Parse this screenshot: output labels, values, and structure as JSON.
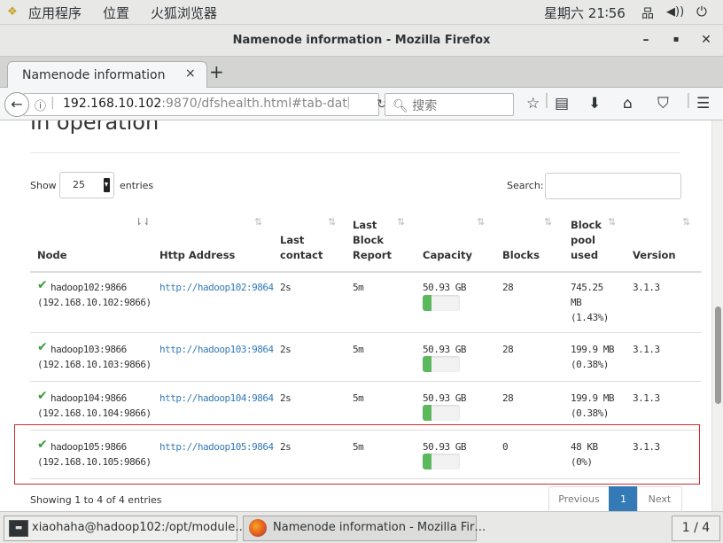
{
  "topbar": {
    "apps": "应用程序",
    "places": "位置",
    "browser": "火狐浏览器",
    "clock": "星期六 21∶56"
  },
  "window": {
    "title": "Namenode information - Mozilla Firefox",
    "minimize": "–",
    "maximize": "▪",
    "close": "✕"
  },
  "tab": {
    "label": "Namenode information",
    "close": "×",
    "new": "+"
  },
  "nav": {
    "url_host": "192.168.10.102",
    "url_rest": ":9870/dfshealth.html#tab-dat",
    "search_placeholder": "搜索"
  },
  "page": {
    "section_title": "In operation",
    "show_label": "Show",
    "page_length": "25",
    "entries_label": "entries",
    "search_label": "Search:",
    "columns": [
      "Node",
      "Http Address",
      "Last contact",
      "Last Block Report",
      "Capacity",
      "Blocks",
      "Block pool used",
      "Version"
    ],
    "rows": [
      {
        "node": "hadoop102:9866",
        "ip": "(192.168.10.102:9866)",
        "http": "http://hadoop102:9864",
        "last_contact": "2s",
        "last_block_report": "5m",
        "capacity": "50.93 GB",
        "used_fraction": 0.0143,
        "blocks": "28",
        "pool_used": [
          "745.25",
          "MB",
          "(1.43%)"
        ],
        "version": "3.1.3"
      },
      {
        "node": "hadoop103:9866",
        "ip": "(192.168.10.103:9866)",
        "http": "http://hadoop103:9864",
        "last_contact": "2s",
        "last_block_report": "5m",
        "capacity": "50.93 GB",
        "used_fraction": 0.0038,
        "blocks": "28",
        "pool_used": [
          "199.9 MB",
          "(0.38%)"
        ],
        "version": "3.1.3"
      },
      {
        "node": "hadoop104:9866",
        "ip": "(192.168.10.104:9866)",
        "http": "http://hadoop104:9864",
        "last_contact": "2s",
        "last_block_report": "5m",
        "capacity": "50.93 GB",
        "used_fraction": 0.0038,
        "blocks": "28",
        "pool_used": [
          "199.9 MB",
          "(0.38%)"
        ],
        "version": "3.1.3"
      },
      {
        "node": "hadoop105:9866",
        "ip": "(192.168.10.105:9866)",
        "http": "http://hadoop105:9864",
        "last_contact": "2s",
        "last_block_report": "5m",
        "capacity": "50.93 GB",
        "used_fraction": 0.0,
        "blocks": "0",
        "pool_used": [
          "48 KB",
          "(0%)"
        ],
        "version": "3.1.3"
      }
    ],
    "info": "Showing 1 to 4 of 4 entries",
    "pagination": {
      "previous": "Previous",
      "current": "1",
      "next": "Next"
    },
    "colors": {
      "link": "#337ab7",
      "bar": "#5cb85c",
      "highlight": "#cc2a2a",
      "active_page": "#337ab7"
    }
  },
  "taskbar": {
    "terminal": "xiaohaha@hadoop102:/opt/module…",
    "firefox": "Namenode information - Mozilla Fir…",
    "workspace": "1 / 4"
  }
}
